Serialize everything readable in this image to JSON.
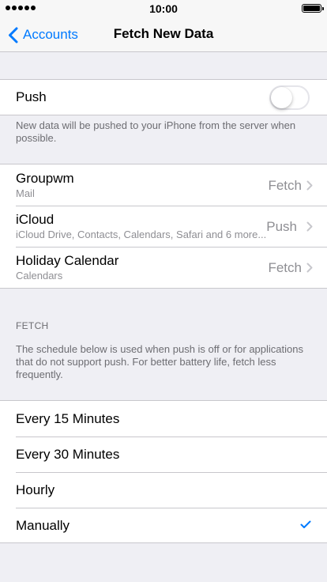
{
  "status_bar": {
    "time": "10:00"
  },
  "nav": {
    "back_label": "Accounts",
    "title": "Fetch New Data"
  },
  "push": {
    "label": "Push",
    "enabled": false,
    "footer": "New data will be pushed to your iPhone from the server when possible."
  },
  "accounts": [
    {
      "name": "Groupwm",
      "detail": "Mail",
      "mode": "Fetch"
    },
    {
      "name": "iCloud",
      "detail": "iCloud Drive, Contacts, Calendars, Safari and 6 more...",
      "mode": "Push"
    },
    {
      "name": "Holiday Calendar",
      "detail": "Calendars",
      "mode": "Fetch"
    }
  ],
  "fetch": {
    "header": "FETCH",
    "footer": "The schedule below is used when push is off or for applications that do not support push. For better battery life, fetch less frequently.",
    "options": [
      "Every 15 Minutes",
      "Every 30 Minutes",
      "Hourly",
      "Manually"
    ],
    "selected": "Manually"
  },
  "colors": {
    "accent": "#007aff",
    "background": "#efeff4",
    "secondary_text": "#8e8e93"
  }
}
